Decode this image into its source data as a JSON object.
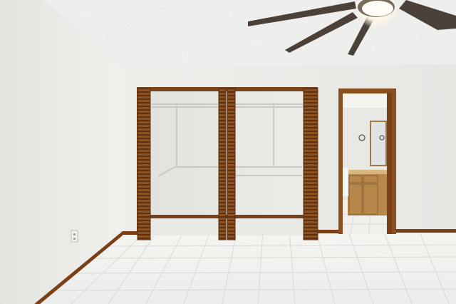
{
  "scene": {
    "description_visible_text": [],
    "colors": {
      "wall": "#ecece9",
      "left_wall": "#e4e4e1",
      "ceiling": "#eeeeec",
      "wood": "#8a4f1f",
      "wood_dark": "#5f3312",
      "floor": "#f1f1ee",
      "grout": "#d9d9d6",
      "baseboard": "#7a3f16",
      "bathroom_cabinet": "#b7874b",
      "fan_blade": "#4a4038"
    },
    "icons": {
      "ceiling_fan": "ceiling-fan-icon",
      "outlet": "outlet-icon",
      "light": "light-icon"
    }
  }
}
